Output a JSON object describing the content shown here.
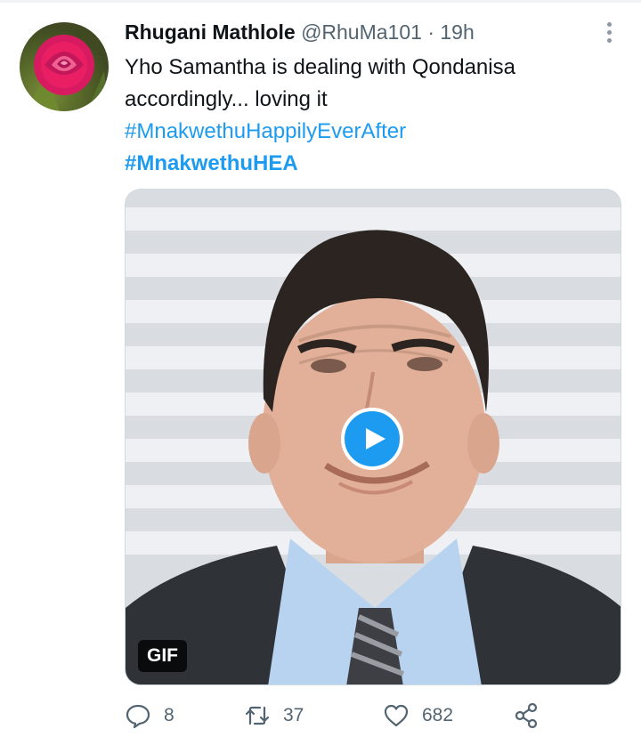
{
  "tweet": {
    "author": {
      "name": "Rhugani Mathlole",
      "handle": "@RhuMa101",
      "separator": "·",
      "time": "19h",
      "avatar_icon": "rose-avatar"
    },
    "text_lines": [
      "Yho Samantha is dealing with Qondanisa",
      "accordingly... loving it"
    ],
    "hashtags": [
      "#MnakwethuHappilyEverAfter",
      "#MnakwethuHEA"
    ],
    "media": {
      "type": "gif",
      "badge": "GIF",
      "play_icon": "play-icon"
    },
    "actions": {
      "reply_count": "8",
      "retweet_count": "37",
      "like_count": "682",
      "share_icon": "share-icon"
    }
  },
  "colors": {
    "accent": "#1d9bf0",
    "text": "#0f1419",
    "secondary": "#536471"
  }
}
